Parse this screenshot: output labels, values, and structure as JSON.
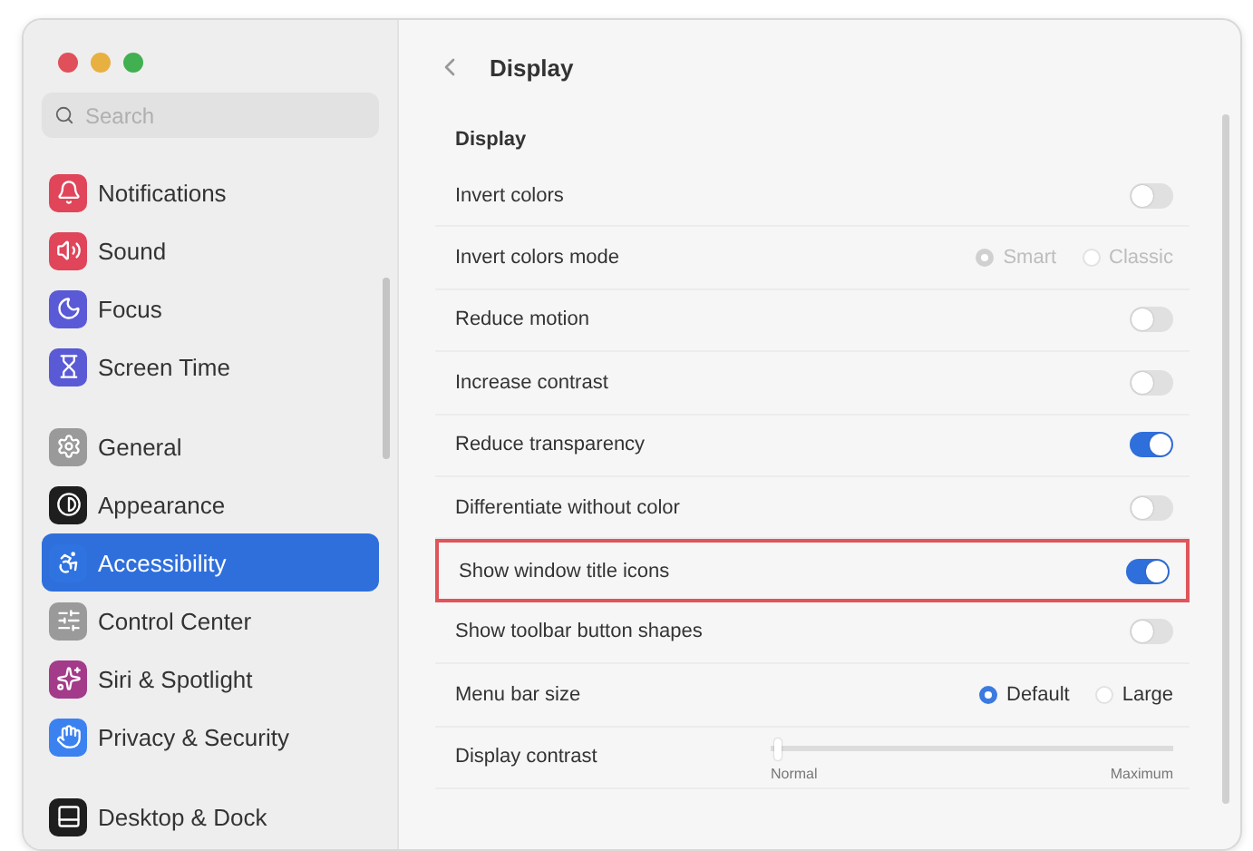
{
  "sidebar": {
    "search": {
      "placeholder": "Search"
    },
    "groups": [
      {
        "items": [
          {
            "label": "Notifications",
            "color": "#e0455a",
            "selected": false
          },
          {
            "label": "Sound",
            "color": "#e0455a",
            "selected": false
          },
          {
            "label": "Focus",
            "color": "#5a5ad6",
            "selected": false
          },
          {
            "label": "Screen Time",
            "color": "#5a5ad6",
            "selected": false
          }
        ]
      },
      {
        "items": [
          {
            "label": "General",
            "color": "#9a9a9a",
            "selected": false
          },
          {
            "label": "Appearance",
            "color": "#1e1e1e",
            "selected": false
          },
          {
            "label": "Accessibility",
            "color": "#2f73e0",
            "selected": true
          },
          {
            "label": "Control Center",
            "color": "#9a9a9a",
            "selected": false
          },
          {
            "label": "Siri & Spotlight",
            "color": "#a33a8a",
            "selected": false
          },
          {
            "label": "Privacy & Security",
            "color": "#3b82f0",
            "selected": false
          }
        ]
      },
      {
        "items": [
          {
            "label": "Desktop & Dock",
            "color": "#1e1e1e",
            "selected": false
          }
        ]
      }
    ]
  },
  "header": {
    "title": "Display"
  },
  "section": {
    "title": "Display",
    "rows": [
      {
        "kind": "toggle",
        "label": "Invert colors",
        "on": false,
        "highlighted": false
      },
      {
        "kind": "radio",
        "label": "Invert colors mode",
        "disabled": true,
        "highlighted": false,
        "options": [
          {
            "label": "Smart",
            "selected": true
          },
          {
            "label": "Classic",
            "selected": false
          }
        ]
      },
      {
        "kind": "toggle",
        "label": "Reduce motion",
        "on": false,
        "highlighted": false
      },
      {
        "kind": "toggle",
        "label": "Increase contrast",
        "on": false,
        "highlighted": false
      },
      {
        "kind": "toggle",
        "label": "Reduce transparency",
        "on": true,
        "highlighted": false
      },
      {
        "kind": "toggle",
        "label": "Differentiate without color",
        "on": false,
        "highlighted": false
      },
      {
        "kind": "toggle",
        "label": "Show window title icons",
        "on": true,
        "highlighted": true
      },
      {
        "kind": "toggle",
        "label": "Show toolbar button shapes",
        "on": false,
        "highlighted": false
      },
      {
        "kind": "radio",
        "label": "Menu bar size",
        "disabled": false,
        "highlighted": false,
        "options": [
          {
            "label": "Default",
            "selected": true
          },
          {
            "label": "Large",
            "selected": false
          }
        ]
      },
      {
        "kind": "slider",
        "label": "Display contrast",
        "highlighted": false,
        "level": 0,
        "min_label": "Normal",
        "max_label": "Maximum"
      }
    ]
  }
}
